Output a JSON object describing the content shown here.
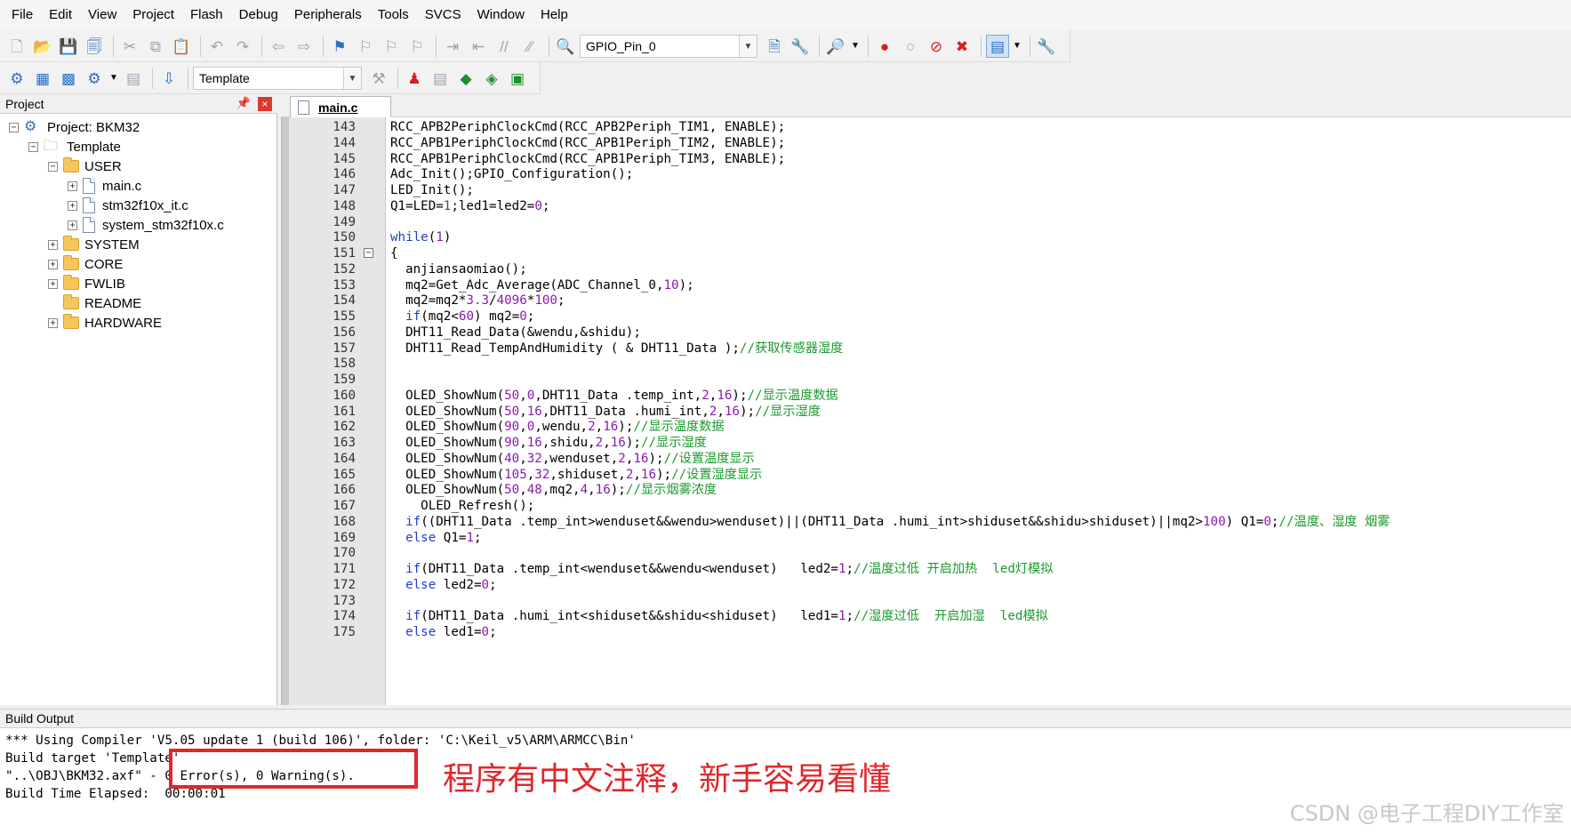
{
  "menu": [
    "File",
    "Edit",
    "View",
    "Project",
    "Flash",
    "Debug",
    "Peripherals",
    "Tools",
    "SVCS",
    "Window",
    "Help"
  ],
  "toolbar": {
    "find_combo": "GPIO_Pin_0",
    "target_combo": "Template"
  },
  "project": {
    "pane_title": "Project",
    "root": "Project: BKM32",
    "target": "Template",
    "groups": {
      "user": "USER",
      "user_files": [
        "main.c",
        "stm32f10x_it.c",
        "system_stm32f10x.c"
      ],
      "system": "SYSTEM",
      "core": "CORE",
      "fwlib": "FWLIB",
      "readme": "README",
      "hardware": "HARDWARE"
    }
  },
  "editor": {
    "tab": "main.c",
    "lines": [
      {
        "n": "143",
        "t": "RCC_APB2PeriphClockCmd(RCC_APB2Periph_TIM1, ENABLE);"
      },
      {
        "n": "144",
        "t": "RCC_APB1PeriphClockCmd(RCC_APB1Periph_TIM2, ENABLE);"
      },
      {
        "n": "145",
        "t": "RCC_APB1PeriphClockCmd(RCC_APB1Periph_TIM3, ENABLE);"
      },
      {
        "n": "146",
        "t": "Adc_Init();GPIO_Configuration();"
      },
      {
        "n": "147",
        "t": "LED_Init();"
      },
      {
        "n": "148",
        "t": "Q1=LED=1;led1=led2=0;"
      },
      {
        "n": "149",
        "t": ""
      },
      {
        "n": "150",
        "t": "while(1)"
      },
      {
        "n": "151",
        "t": "{"
      },
      {
        "n": "152",
        "t": "  anjiansaomiao();"
      },
      {
        "n": "153",
        "t": "  mq2=Get_Adc_Average(ADC_Channel_0,10);"
      },
      {
        "n": "154",
        "t": "  mq2=mq2*3.3/4096*100;"
      },
      {
        "n": "155",
        "t": "  if(mq2<60) mq2=0;"
      },
      {
        "n": "156",
        "t": "  DHT11_Read_Data(&wendu,&shidu);"
      },
      {
        "n": "157",
        "t": "  DHT11_Read_TempAndHumidity ( & DHT11_Data );//获取传感器湿度"
      },
      {
        "n": "158",
        "t": ""
      },
      {
        "n": "159",
        "t": ""
      },
      {
        "n": "160",
        "t": "  OLED_ShowNum(50,0,DHT11_Data .temp_int,2,16);//显示温度数据"
      },
      {
        "n": "161",
        "t": "  OLED_ShowNum(50,16,DHT11_Data .humi_int,2,16);//显示湿度"
      },
      {
        "n": "162",
        "t": "  OLED_ShowNum(90,0,wendu,2,16);//显示温度数据"
      },
      {
        "n": "163",
        "t": "  OLED_ShowNum(90,16,shidu,2,16);//显示湿度"
      },
      {
        "n": "164",
        "t": "  OLED_ShowNum(40,32,wenduset,2,16);//设置温度显示"
      },
      {
        "n": "165",
        "t": "  OLED_ShowNum(105,32,shiduset,2,16);//设置湿度显示"
      },
      {
        "n": "166",
        "t": "  OLED_ShowNum(50,48,mq2,4,16);//显示烟雾浓度"
      },
      {
        "n": "167",
        "t": "    OLED_Refresh();"
      },
      {
        "n": "168",
        "t": "  if((DHT11_Data .temp_int>wenduset&&wendu>wenduset)||(DHT11_Data .humi_int>shiduset&&shidu>shiduset)||mq2>100) Q1=0;//温度、湿度 烟雾"
      },
      {
        "n": "169",
        "t": "  else Q1=1;"
      },
      {
        "n": "170",
        "t": ""
      },
      {
        "n": "171",
        "t": "  if(DHT11_Data .temp_int<wenduset&&wendu<wenduset)   led2=1;//温度过低 开启加热  led灯模拟"
      },
      {
        "n": "172",
        "t": "  else led2=0;"
      },
      {
        "n": "173",
        "t": ""
      },
      {
        "n": "174",
        "t": "  if(DHT11_Data .humi_int<shiduset&&shidu<shiduset)   led1=1;//湿度过低  开启加湿  led模拟"
      },
      {
        "n": "175",
        "t": "  else led1=0;"
      }
    ]
  },
  "build": {
    "title": "Build Output",
    "line1": "*** Using Compiler 'V5.05 update 1 (build 106)', folder: 'C:\\Keil_v5\\ARM\\ARMCC\\Bin'",
    "line2": "Build target 'Template'",
    "line3": "\"..\\OBJ\\BKM32.axf\" - 0 Error(s), 0 Warning(s).",
    "line4": "Build Time Elapsed:  00:00:01",
    "annotation": "程序有中文注释，新手容易看懂",
    "watermark": "CSDN @电子工程DIY工作室"
  }
}
